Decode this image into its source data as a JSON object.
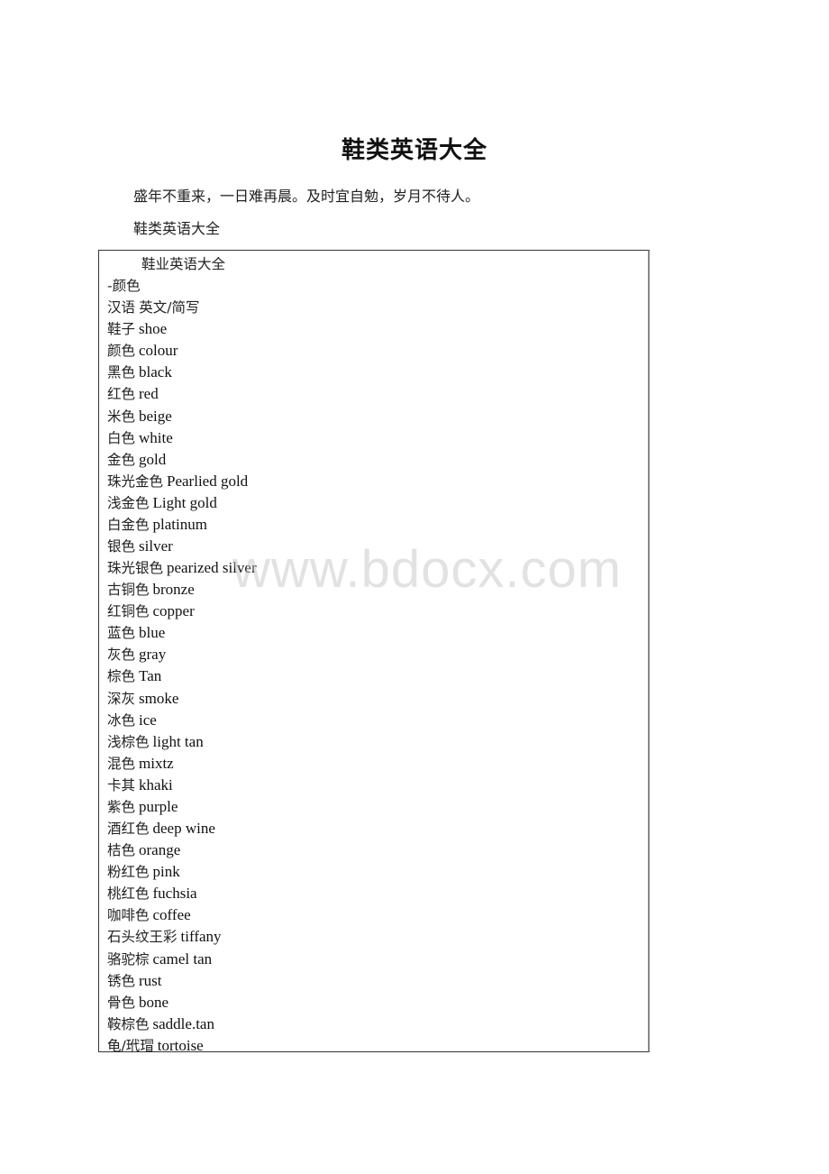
{
  "document": {
    "title": "鞋类英语大全",
    "intro": "盛年不重来，一日难再晨。及时宜自勉，岁月不待人。",
    "subtitle": "鞋类英语大全"
  },
  "box": {
    "heading": "鞋业英语大全",
    "section": "-颜色",
    "column_header": {
      "zh": "汉语",
      "en": "英文/简写"
    },
    "entries": [
      {
        "zh": "鞋子",
        "en": "shoe"
      },
      {
        "zh": "颜色",
        "en": "colour"
      },
      {
        "zh": "黑色",
        "en": "black"
      },
      {
        "zh": "红色",
        "en": "red"
      },
      {
        "zh": "米色",
        "en": "beige"
      },
      {
        "zh": "白色",
        "en": "white"
      },
      {
        "zh": "金色",
        "en": "gold"
      },
      {
        "zh": "珠光金色",
        "en": "Pearlied gold"
      },
      {
        "zh": "浅金色",
        "en": "Light gold"
      },
      {
        "zh": "白金色",
        "en": "platinum"
      },
      {
        "zh": "银色",
        "en": "silver"
      },
      {
        "zh": "珠光银色",
        "en": "pearized silver"
      },
      {
        "zh": "古铜色",
        "en": "bronze"
      },
      {
        "zh": "红铜色",
        "en": "copper"
      },
      {
        "zh": "蓝色",
        "en": "blue"
      },
      {
        "zh": "灰色",
        "en": "gray"
      },
      {
        "zh": "棕色",
        "en": "Tan"
      },
      {
        "zh": "深灰",
        "en": "smoke"
      },
      {
        "zh": "冰色",
        "en": "ice"
      },
      {
        "zh": "浅棕色",
        "en": "light tan"
      },
      {
        "zh": "混色",
        "en": "mixtz"
      },
      {
        "zh": "卡其",
        "en": "khaki"
      },
      {
        "zh": "紫色",
        "en": "purple"
      },
      {
        "zh": "酒红色",
        "en": "deep wine"
      },
      {
        "zh": "桔色",
        "en": "orange"
      },
      {
        "zh": "粉红色",
        "en": "pink"
      },
      {
        "zh": "桃红色",
        "en": "fuchsia"
      },
      {
        "zh": "咖啡色",
        "en": "coffee"
      },
      {
        "zh": "石头纹王彩",
        "en": "tiffany"
      },
      {
        "zh": "骆驼棕",
        "en": "camel tan"
      },
      {
        "zh": "锈色",
        "en": "rust"
      },
      {
        "zh": "骨色",
        "en": "bone"
      },
      {
        "zh": "鞍棕色",
        "en": "saddle.tan"
      },
      {
        "zh": "龟/玳瑁",
        "en": "tortoise"
      }
    ]
  },
  "watermark": "www.bdocx.com"
}
